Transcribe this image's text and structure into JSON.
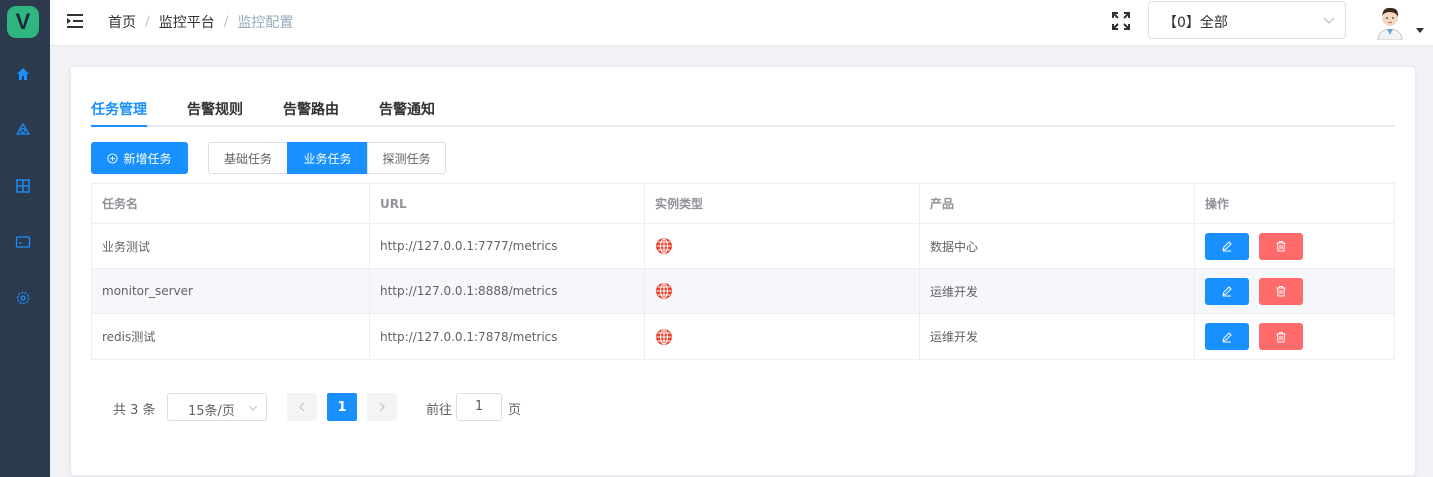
{
  "logo": {
    "letter": "V"
  },
  "sidebar": {
    "items": [
      {
        "name": "home-icon"
      },
      {
        "name": "monitor-icon"
      },
      {
        "name": "grid-icon"
      },
      {
        "name": "dashboard-icon"
      },
      {
        "name": "settings-icon"
      }
    ]
  },
  "header": {
    "breadcrumb": [
      "首页",
      "监控平台",
      "监控配置"
    ],
    "scope_select": "【0】全部"
  },
  "tabs": [
    {
      "label": "任务管理",
      "active": true
    },
    {
      "label": "告警规则",
      "active": false
    },
    {
      "label": "告警路由",
      "active": false
    },
    {
      "label": "告警通知",
      "active": false
    }
  ],
  "toolbar": {
    "add_label": "新增任务",
    "segments": [
      {
        "label": "基础任务",
        "active": false
      },
      {
        "label": "业务任务",
        "active": true
      },
      {
        "label": "探测任务",
        "active": false
      }
    ]
  },
  "table": {
    "columns": [
      "任务名",
      "URL",
      "实例类型",
      "产品",
      "操作"
    ],
    "rows": [
      {
        "name": "业务测试",
        "url": "http://127.0.0.1:7777/metrics",
        "type_icon": "globe-icon",
        "product": "数据中心"
      },
      {
        "name": "monitor_server",
        "url": "http://127.0.0.1:8888/metrics",
        "type_icon": "globe-icon",
        "product": "运维开发"
      },
      {
        "name": "redis测试",
        "url": "http://127.0.0.1:7878/metrics",
        "type_icon": "globe-icon",
        "product": "运维开发"
      }
    ]
  },
  "pagination": {
    "total_text": "共 3 条",
    "page_size": "15条/页",
    "current_page": "1",
    "goto_label": "前往",
    "goto_value": "1",
    "page_suffix": "页"
  },
  "colors": {
    "primary": "#1890ff",
    "danger": "#ff6b6b",
    "sidebar": "#2b3a4c",
    "brand": "#2fb680"
  }
}
